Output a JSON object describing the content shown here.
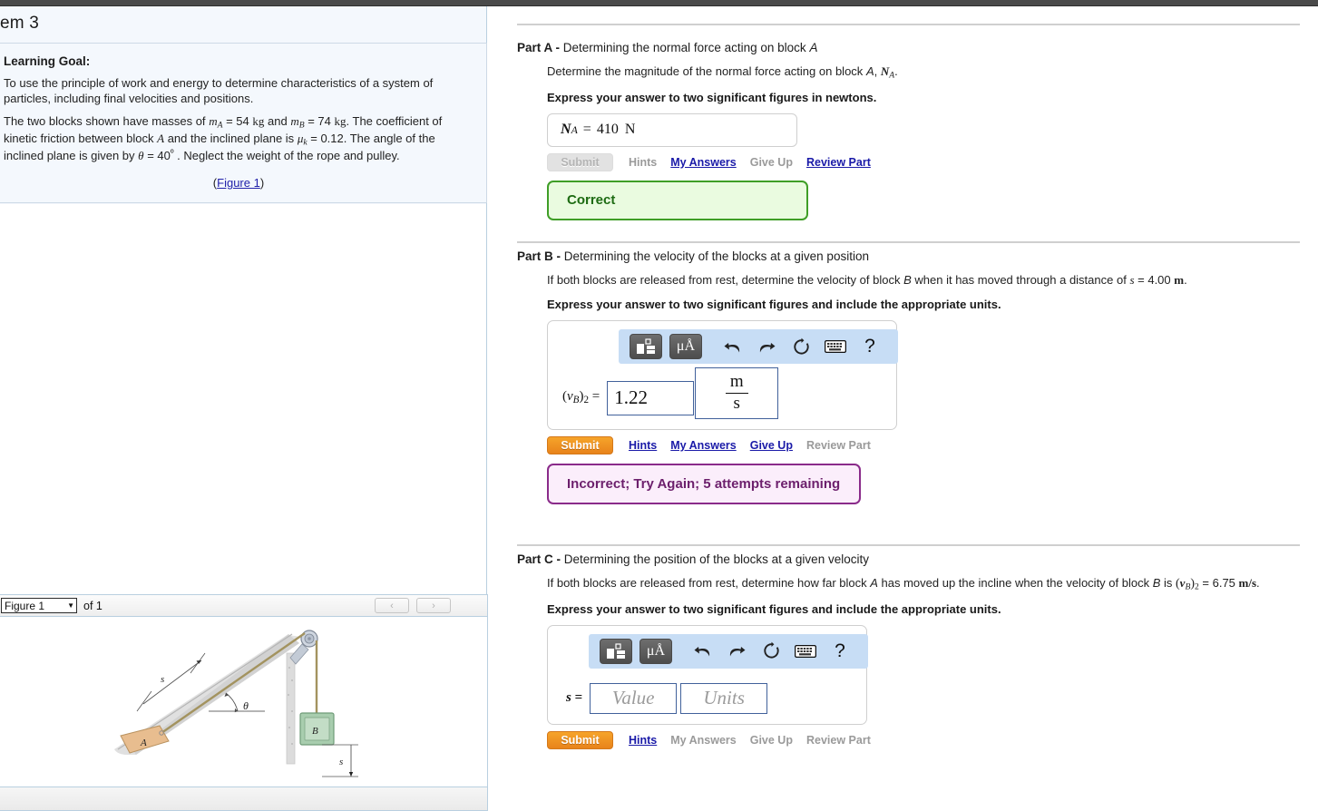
{
  "problem": {
    "title": "em 3",
    "learning_goal_label": "Learning Goal:",
    "goal_text": "To use the principle of work and energy to determine characteristics of a system of particles, including final velocities and positions.",
    "setup_text_1": "The two blocks shown have masses of",
    "m_a_symbol": "m",
    "m_a_sub": "A",
    "m_a_value": "= 54",
    "m_a_unit": "kg",
    "setup_and": "and",
    "m_b_symbol": "m",
    "m_b_sub": "B",
    "m_b_value": "= 74",
    "m_b_unit": "kg",
    "setup_text_2": ". The coefficient of kinetic friction between block",
    "block_a": "A",
    "setup_text_3": "and the inclined plane is",
    "mu_symbol": "μ",
    "mu_sub": "k",
    "mu_value": "= 0.12",
    "setup_text_4": ". The angle of the inclined plane is given by",
    "theta_symbol": "θ",
    "theta_value": "= 40",
    "degree": "º",
    "setup_text_5": ". Neglect the weight of the rope and pulley.",
    "figure_link": "Figure 1",
    "paren_open": "(",
    "paren_close": ")"
  },
  "figure_viewer": {
    "select_value": "Figure 1",
    "caret": "▼",
    "of_label": "of 1",
    "prev_label": "‹",
    "next_label": "›",
    "diagram": {
      "block_a_label": "A",
      "block_b_label": "B",
      "theta_label": "θ",
      "s_incline_label": "s",
      "s_vertical_label": "s"
    }
  },
  "toolbar": {
    "template_icon": "template-icon",
    "units_icon": "μÅ",
    "undo_icon": "↶",
    "redo_icon": "↷",
    "reset_icon": "↻",
    "keyboard_icon": "keyboard-icon",
    "help_icon": "?"
  },
  "links": {
    "submit": "Submit",
    "hints": "Hints",
    "my_answers": "My Answers",
    "give_up": "Give Up",
    "review_part": "Review Part"
  },
  "colors": {
    "submit_orange": "#e8831b",
    "correct_green": "#3f9e27",
    "correct_bg": "#eafbe0",
    "incorrect_purple": "#8a2b8a",
    "incorrect_bg": "#fbeefb",
    "link_blue": "#1a1aa8",
    "toolbar_blue": "#c7ddf5",
    "input_border": "#41619b"
  },
  "parts": {
    "a": {
      "label": "Part A -",
      "heading": "Determining the normal force acting on block",
      "heading_italic": "A",
      "question": "Determine the magnitude of the normal force acting on block",
      "question_italic": "A",
      "question_symbol": "N",
      "question_sub": "A",
      "question_end": ".",
      "instruction": "Express your answer to two significant figures in newtons.",
      "answer_symbol": "N",
      "answer_sub": "A",
      "answer_eq": "=",
      "answer_value": "410",
      "answer_unit": "N",
      "feedback": "Correct",
      "submit_enabled": false
    },
    "b": {
      "label": "Part B -",
      "heading": "Determining the velocity of the blocks at a given position",
      "q1": "If both blocks are released from rest, determine the velocity of block",
      "q_italic": "B",
      "q2": "when it has moved through a distance of",
      "q_s": "s",
      "q_s_val": "= 4.00",
      "q_s_unit": "m",
      "q_end": ".",
      "instruction": "Express your answer to two significant figures and include the appropriate units.",
      "answer_label_open": "(",
      "answer_label_v": "v",
      "answer_label_sub": "B",
      "answer_label_close": ")",
      "answer_label_sub2": "2",
      "answer_eq": "=",
      "answer_value": "1.22",
      "unit_numerator": "m",
      "unit_denominator": "s",
      "feedback": "Incorrect; Try Again; 5 attempts remaining",
      "submit_enabled": true
    },
    "c": {
      "label": "Part C -",
      "heading": "Determining the position of the blocks at a given velocity",
      "q1": "If both blocks are released from rest, determine how far block",
      "q_italic": "A",
      "q2": "has moved up the incline when the velocity of block",
      "q_italic2": "B",
      "q3": "is",
      "q_v_open": "(",
      "q_v": "v",
      "q_v_sub": "B",
      "q_v_close": ")",
      "q_v_sub2": "2",
      "q_v_val": "= 6.75",
      "q_v_unit": "m/s",
      "q_end": ".",
      "instruction": "Express your answer to two significant figures and include the appropriate units.",
      "answer_label": "s",
      "answer_eq": "=",
      "value_placeholder": "Value",
      "units_placeholder": "Units",
      "submit_enabled": true
    }
  }
}
